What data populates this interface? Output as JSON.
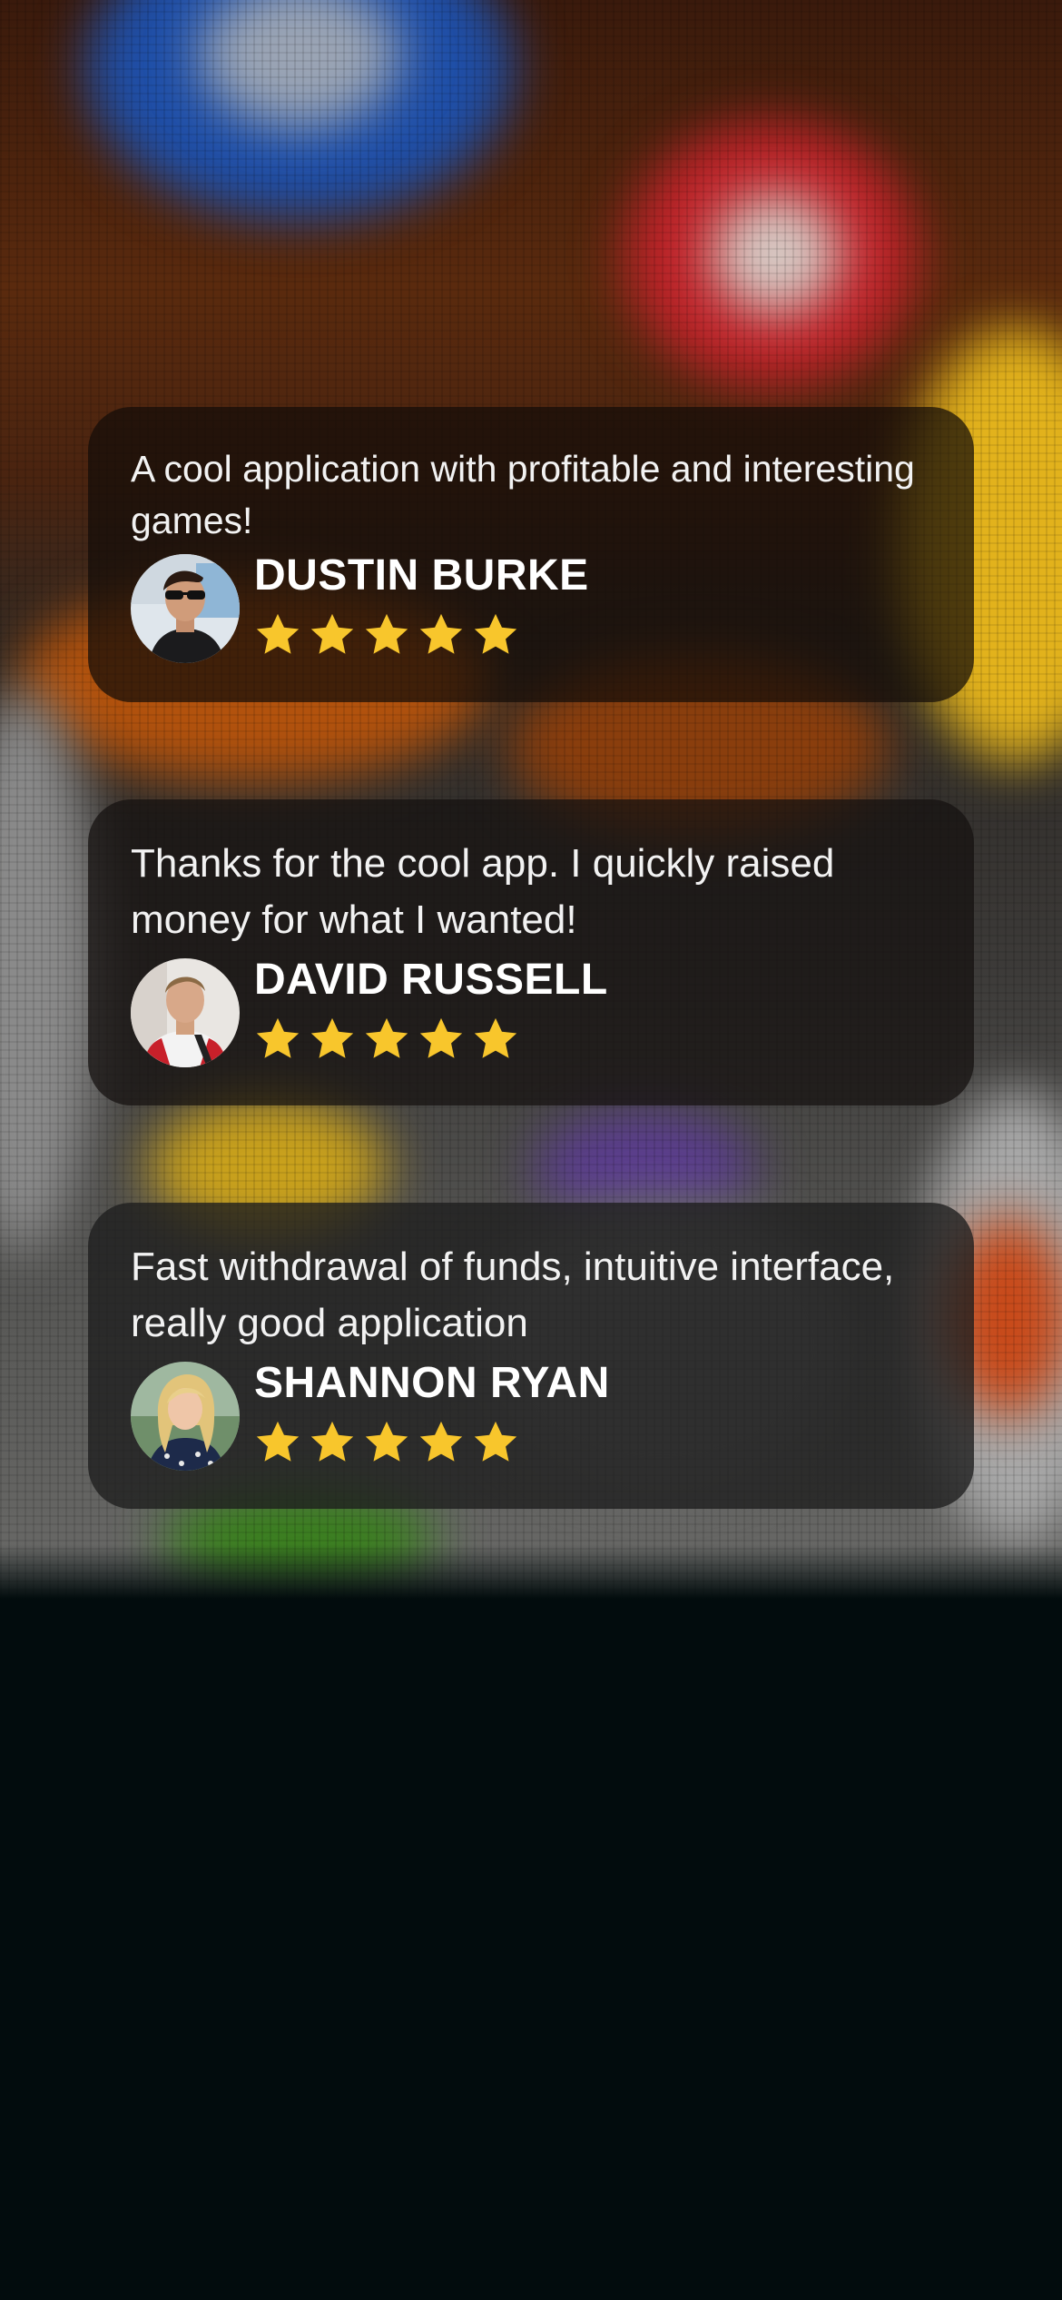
{
  "reviews": [
    {
      "text": "A cool application with profitable and interesting games!",
      "author": "DUSTIN BURKE",
      "rating": 5,
      "rating_max": 5,
      "avatar_icon": "avatar-photo-man-sunglasses"
    },
    {
      "text": "Thanks for the cool app. I quickly raised money for what I wanted!",
      "author": "DAVID RUSSELL",
      "rating": 5,
      "rating_max": 5,
      "avatar_icon": "avatar-photo-man-jacket"
    },
    {
      "text": "Fast withdrawal of funds, intuitive interface, really good application",
      "author": "SHANNON RYAN",
      "rating": 5,
      "rating_max": 5,
      "avatar_icon": "avatar-photo-woman-blonde"
    }
  ],
  "colors": {
    "star": "#f8c62c",
    "page_background": "#020c0d",
    "card_text": "#f2f2f2"
  },
  "icons": {
    "star": "star-icon"
  }
}
